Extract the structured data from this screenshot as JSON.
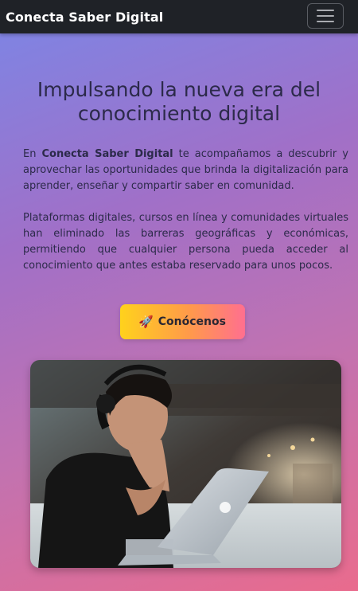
{
  "navbar": {
    "brand": "Conecta Saber Digital",
    "toggle_icon": "hamburger-menu-icon"
  },
  "hero": {
    "title": "Impulsando la nueva era del conocimiento digital",
    "paragraph1": {
      "prefix": "En ",
      "brand_bold": "Conecta Saber Digital",
      "suffix": " te acompañamos a descubrir y aprovechar las oportunidades que brinda la digitalización para aprender, enseñar y compartir saber en comunidad."
    },
    "paragraph2": "Plataformas digitales, cursos en línea y comunidades virtuales han eliminado las barreras geográficas y económicas, permitiendo que cualquier persona pueda acceder al conocimiento que antes estaba reservado para unos pocos.",
    "cta": {
      "icon": "🚀",
      "label": "Conócenos"
    }
  },
  "image": {
    "subject": "man-with-headphones-at-laptop"
  },
  "colors": {
    "navbar_bg": "#1f2227",
    "gradient_start": "#7b86e6",
    "gradient_end": "#e96b8d",
    "cta_start": "#ffd21c",
    "cta_end": "#ff6f8f"
  }
}
